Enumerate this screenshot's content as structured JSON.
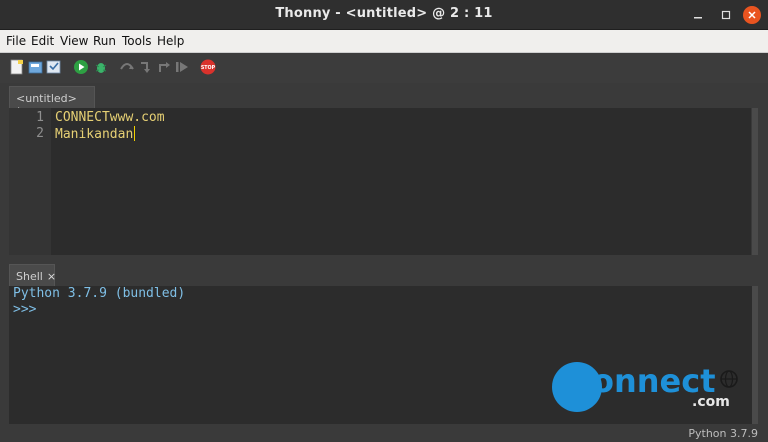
{
  "window": {
    "title": "Thonny  -  <untitled>  @  2 : 11"
  },
  "menu": [
    "File",
    "Edit",
    "View",
    "Run",
    "Tools",
    "Help"
  ],
  "toolbar": {
    "icons": [
      "new-file-icon",
      "open-file-icon",
      "save-file-icon",
      "run-icon",
      "debug-icon",
      "step-over-icon",
      "step-into-icon",
      "step-out-icon",
      "resume-icon",
      "stop-icon"
    ],
    "stop_label": "STOP"
  },
  "editor": {
    "tab_label": "<untitled> *",
    "tab_close": "×",
    "lines": [
      {
        "number": "1",
        "text": "CONNECTwww.com"
      },
      {
        "number": "2",
        "text": "Manikandan"
      }
    ]
  },
  "shell": {
    "tab_label": "Shell",
    "tab_close": "×",
    "lines": [
      "Python 3.7.9 (bundled)",
      ">>>"
    ]
  },
  "status": {
    "version": "Python 3.7.9"
  },
  "watermark": {
    "text": "onnect",
    "suffix": ".com"
  },
  "colors": {
    "editor_text": "#e6d074",
    "shell_text": "#7fbfe6",
    "close_button": "#e95420",
    "logo_blue": "#1e90d8"
  }
}
